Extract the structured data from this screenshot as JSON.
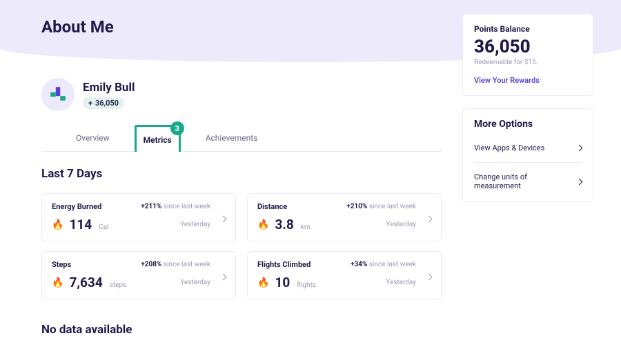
{
  "page_title": "About Me",
  "profile": {
    "name": "Emily Bull",
    "points_pill_prefix": "+",
    "points_pill_value": "36,050"
  },
  "tabs": {
    "overview": "Overview",
    "metrics": "Metrics",
    "metrics_badge": "3",
    "achievements": "Achievements"
  },
  "section_last7": "Last 7 Days",
  "metrics": [
    {
      "title": "Energy Burned",
      "delta": "+211%",
      "delta_suffix": "since last week",
      "value": "114",
      "unit": "Cal",
      "timeref": "Yesterday"
    },
    {
      "title": "Distance",
      "delta": "+210%",
      "delta_suffix": "since last week",
      "value": "3.8",
      "unit": "km",
      "timeref": "Yesterday"
    },
    {
      "title": "Steps",
      "delta": "+208%",
      "delta_suffix": "since last week",
      "value": "7,634",
      "unit": "steps",
      "timeref": "Yesterday"
    },
    {
      "title": "Flights Climbed",
      "delta": "+34%",
      "delta_suffix": "since last week",
      "value": "10",
      "unit": "flights",
      "timeref": "Yesterday"
    }
  ],
  "nodata": "No data available",
  "points_card": {
    "label": "Points Balance",
    "value": "36,050",
    "redeem": "Redeemable for $15.",
    "link": "View Your Rewards"
  },
  "more_options": {
    "label": "More Options",
    "opt1": "View Apps & Devices",
    "opt2": "Change units of measurement"
  },
  "icons": {
    "fire": "🔥"
  }
}
